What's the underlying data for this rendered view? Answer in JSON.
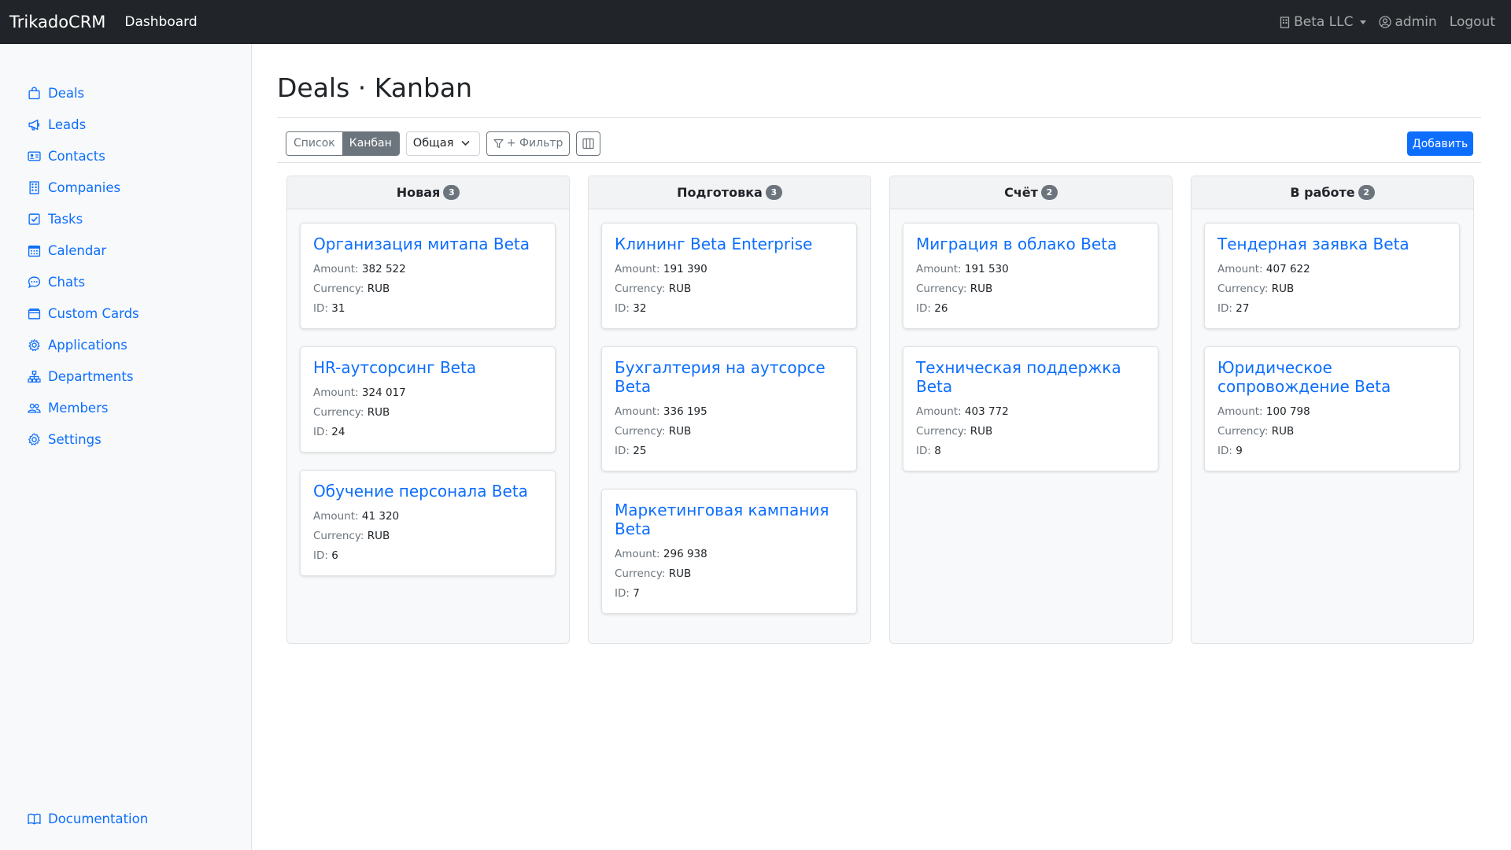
{
  "navbar": {
    "brand": "TrikadoCRM",
    "dashboard_link": "Dashboard",
    "company": "Beta LLC",
    "user": "admin",
    "logout": "Logout"
  },
  "sidebar": {
    "items": [
      {
        "label": "Deals",
        "icon": "bag-icon"
      },
      {
        "label": "Leads",
        "icon": "megaphone-icon"
      },
      {
        "label": "Contacts",
        "icon": "person-card-icon"
      },
      {
        "label": "Companies",
        "icon": "building-icon"
      },
      {
        "label": "Tasks",
        "icon": "check-square-icon"
      },
      {
        "label": "Calendar",
        "icon": "calendar-icon"
      },
      {
        "label": "Chats",
        "icon": "chat-icon"
      },
      {
        "label": "Custom Cards",
        "icon": "folder-icon"
      },
      {
        "label": "Applications",
        "icon": "gear-wide-icon"
      },
      {
        "label": "Departments",
        "icon": "diagram-icon"
      },
      {
        "label": "Members",
        "icon": "people-icon"
      },
      {
        "label": "Settings",
        "icon": "gear-icon"
      }
    ],
    "documentation": "Documentation"
  },
  "page": {
    "title": "Deals · Kanban"
  },
  "toolbar": {
    "view_list": "Список",
    "view_kanban": "Канбан",
    "pipeline_select": "Общая",
    "filter_label": "+ Фильтр",
    "add_label": "Добавить"
  },
  "columns": [
    {
      "title": "Новая",
      "count": "3",
      "cards": [
        {
          "title": "Организация митапа Beta",
          "amount": "382 522",
          "currency": "RUB",
          "id": "31"
        },
        {
          "title": "HR-аутсорсинг Beta",
          "amount": "324 017",
          "currency": "RUB",
          "id": "24"
        },
        {
          "title": "Обучение персонала Beta",
          "amount": "41 320",
          "currency": "RUB",
          "id": "6"
        }
      ]
    },
    {
      "title": "Подготовка",
      "count": "3",
      "cards": [
        {
          "title": "Клининг Beta Enterprise",
          "amount": "191 390",
          "currency": "RUB",
          "id": "32"
        },
        {
          "title": "Бухгалтерия на аутсорсе Beta",
          "amount": "336 195",
          "currency": "RUB",
          "id": "25"
        },
        {
          "title": "Маркетинговая кампания Beta",
          "amount": "296 938",
          "currency": "RUB",
          "id": "7"
        }
      ]
    },
    {
      "title": "Счёт",
      "count": "2",
      "cards": [
        {
          "title": "Миграция в облако Beta",
          "amount": "191 530",
          "currency": "RUB",
          "id": "26"
        },
        {
          "title": "Техническая поддержка Beta",
          "amount": "403 772",
          "currency": "RUB",
          "id": "8"
        }
      ]
    },
    {
      "title": "В работе",
      "count": "2",
      "cards": [
        {
          "title": "Тендерная заявка Beta",
          "amount": "407 622",
          "currency": "RUB",
          "id": "27"
        },
        {
          "title": "Юридическое сопровождение Beta",
          "amount": "100 798",
          "currency": "RUB",
          "id": "9"
        }
      ]
    }
  ],
  "labels": {
    "amount": "Amount:",
    "currency": "Currency:",
    "id": "ID:"
  },
  "colors": {
    "navbar_bg": "#212529",
    "link": "#0d6efd",
    "sidebar_bg": "#f8f9fa",
    "badge": "#6c757d"
  }
}
